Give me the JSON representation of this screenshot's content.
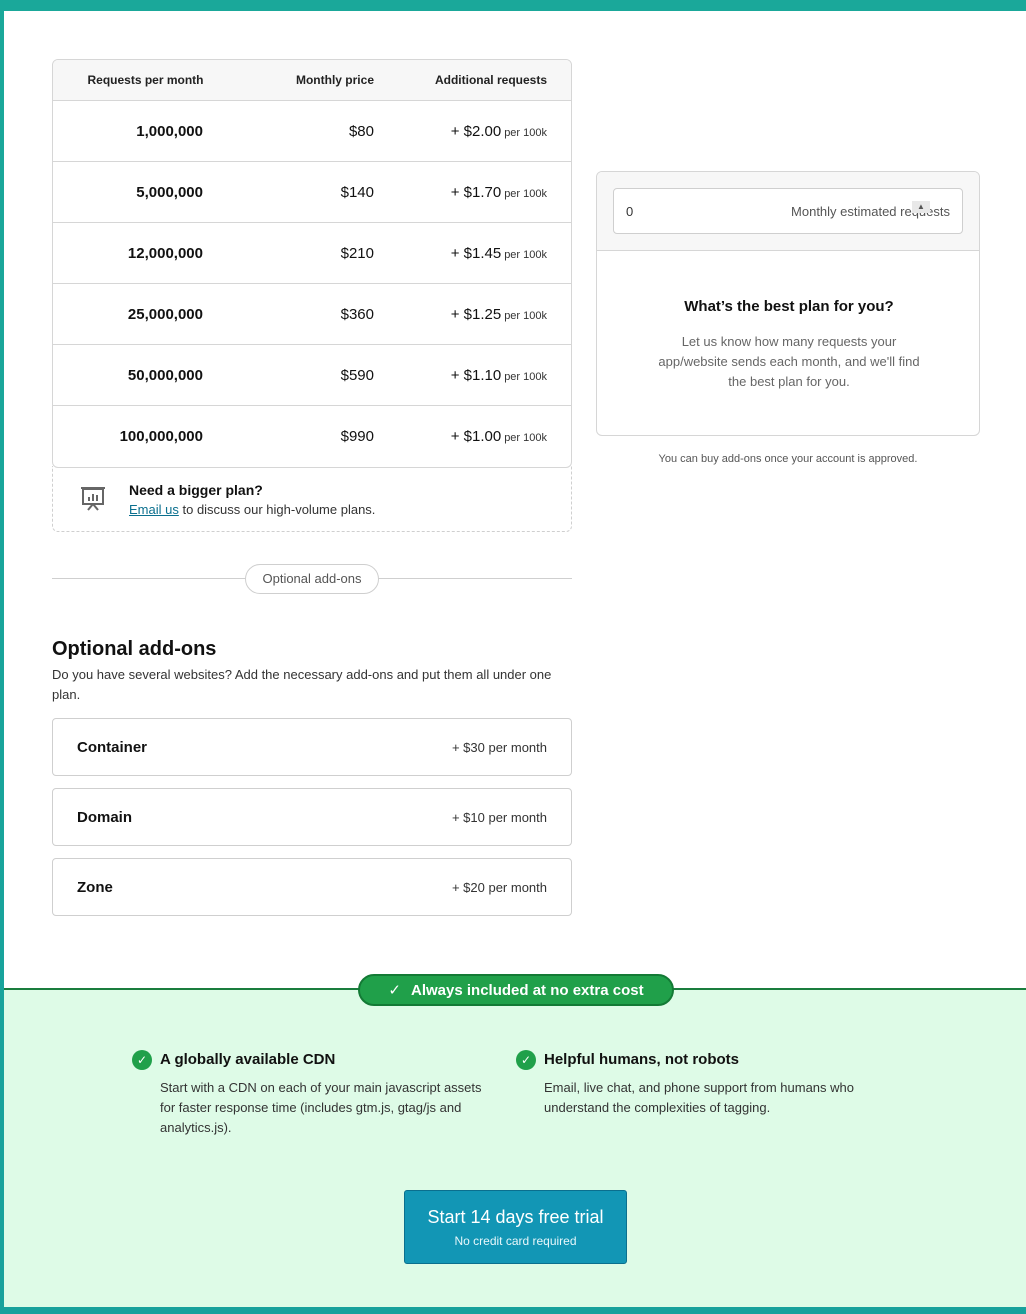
{
  "pricing_table": {
    "headers": [
      "Requests per month",
      "Monthly price",
      "Additional requests"
    ],
    "per_label": "per 100k",
    "rows": [
      {
        "requests": "1,000,000",
        "price": "$80",
        "additional": "+ $2.00"
      },
      {
        "requests": "5,000,000",
        "price": "$140",
        "additional": "+ $1.70"
      },
      {
        "requests": "12,000,000",
        "price": "$210",
        "additional": "+ $1.45"
      },
      {
        "requests": "25,000,000",
        "price": "$360",
        "additional": "+ $1.25"
      },
      {
        "requests": "50,000,000",
        "price": "$590",
        "additional": "+ $1.10"
      },
      {
        "requests": "100,000,000",
        "price": "$990",
        "additional": "+ $1.00"
      }
    ]
  },
  "bigger_plan": {
    "title": "Need a bigger plan?",
    "link": "Email us",
    "text": "to discuss our high-volume plans."
  },
  "divider_label": "Optional add-ons",
  "addons": {
    "title": "Optional add-ons",
    "description": "Do you have several websites? Add the necessary add-ons and put them all under one plan.",
    "items": [
      {
        "name": "Container",
        "price": "+ $30 per month"
      },
      {
        "name": "Domain",
        "price": "+ $10 per month"
      },
      {
        "name": "Zone",
        "price": "+ $20 per month"
      }
    ]
  },
  "estimator": {
    "value": "0",
    "placeholder": "Monthly estimated requests",
    "question": "What’s the best plan for you?",
    "answer": "Let us know how many requests your app/website sends each month, and we'll find the best plan for you.",
    "note": "You can buy add-ons once your account is approved."
  },
  "included": {
    "badge": "Always included at no extra cost",
    "features": [
      {
        "title": "A globally available CDN",
        "text": "Start with a CDN on each of your main javascript assets for faster response time (includes gtm.js, gtag/js and analytics.js)."
      },
      {
        "title": "Helpful humans, not robots",
        "text": "Email, live chat, and phone support from humans who understand the complexities of tagging."
      }
    ]
  },
  "cta": {
    "label": "Start 14 days free trial",
    "sub": "No credit card required"
  },
  "colors": {
    "accent": "#1296b5",
    "success": "#20a04a",
    "band": "#defbe7"
  }
}
